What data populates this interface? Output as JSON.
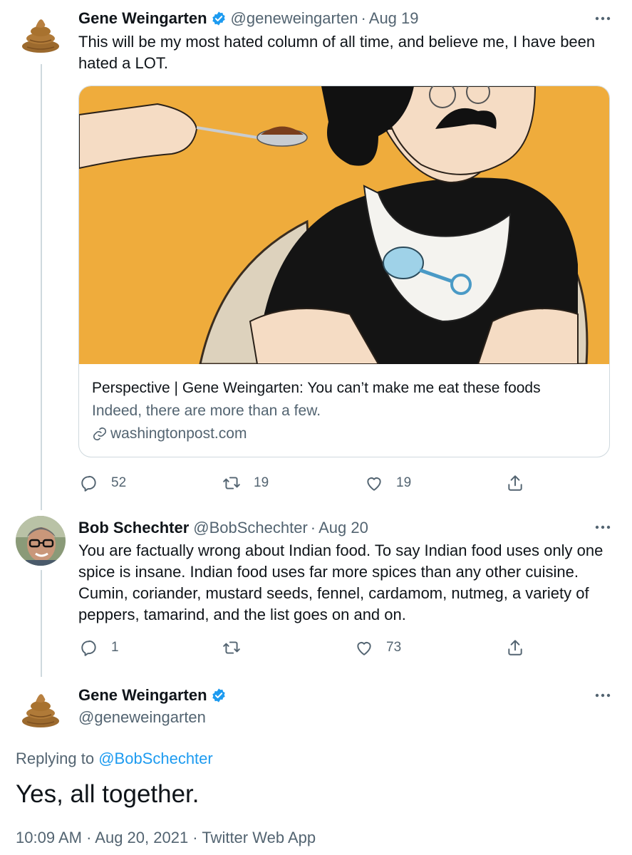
{
  "tweet1": {
    "name": "Gene Weingarten",
    "handle": "@geneweingarten",
    "separator": "·",
    "date": "Aug 19",
    "text": "This will be my most hated column of all time, and believe me, I have been hated a LOT.",
    "card": {
      "title": "Perspective | Gene Weingarten: You can’t make me eat these foods",
      "description": "Indeed, there are more than a few.",
      "domain": "washingtonpost.com"
    },
    "replies": "52",
    "retweets": "19",
    "likes": "19"
  },
  "tweet2": {
    "name": "Bob Schechter",
    "handle": "@BobSchechter",
    "separator": "·",
    "date": "Aug 20",
    "text": "You are factually wrong about Indian food. To say Indian food uses only one spice is insane. Indian food uses far more spices than any other cuisine. Cumin, coriander, mustard seeds, fennel, cardamom, nutmeg, a variety of peppers, tamarind, and the list goes on and on.",
    "replies": "1",
    "retweets": "",
    "likes": "73"
  },
  "tweet3": {
    "name": "Gene Weingarten",
    "handle": "@geneweingarten",
    "replying_label": "Replying to",
    "replying_to": "@BobSchechter",
    "text": "Yes, all together.",
    "timestamp": "10:09 AM · Aug 20, 2021 · Twitter Web App"
  },
  "colors": {
    "text": "#0f1419",
    "muted": "#536471",
    "link": "#1d9bf0",
    "border": "#cfd9de",
    "card_background": "#efac3c"
  },
  "icons": [
    "verified-icon",
    "more-icon",
    "reply-icon",
    "retweet-icon",
    "like-icon",
    "share-icon",
    "link-icon"
  ]
}
